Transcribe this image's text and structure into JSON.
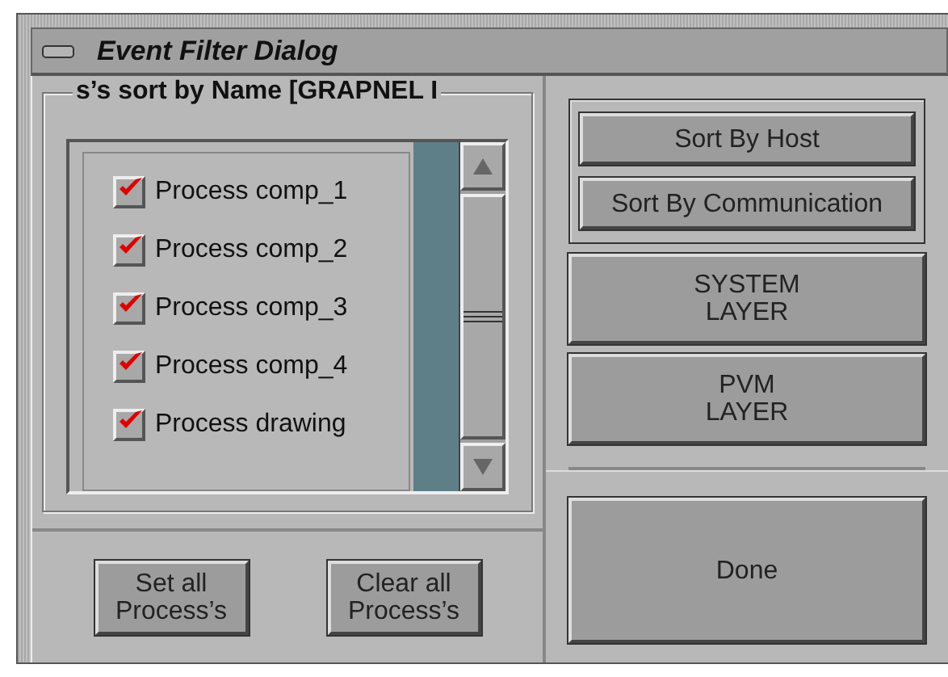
{
  "window": {
    "title": "Event Filter Dialog"
  },
  "group": {
    "title": "s’s sort by Name [GRAPNEL I"
  },
  "items": [
    {
      "label": "Process comp_1",
      "checked": true
    },
    {
      "label": "Process comp_2",
      "checked": true
    },
    {
      "label": "Process comp_3",
      "checked": true
    },
    {
      "label": "Process comp_4",
      "checked": true
    },
    {
      "label": "Process drawing",
      "checked": true
    }
  ],
  "bottom_buttons": [
    "Set all\nProcess’s",
    "Clear all\nProcess’s"
  ],
  "sort_buttons": [
    "Sort By Host",
    "Sort By Communication"
  ],
  "layer_buttons": [
    "SYSTEM\nLAYER",
    "PVM\nLAYER"
  ],
  "done_button": "Done"
}
